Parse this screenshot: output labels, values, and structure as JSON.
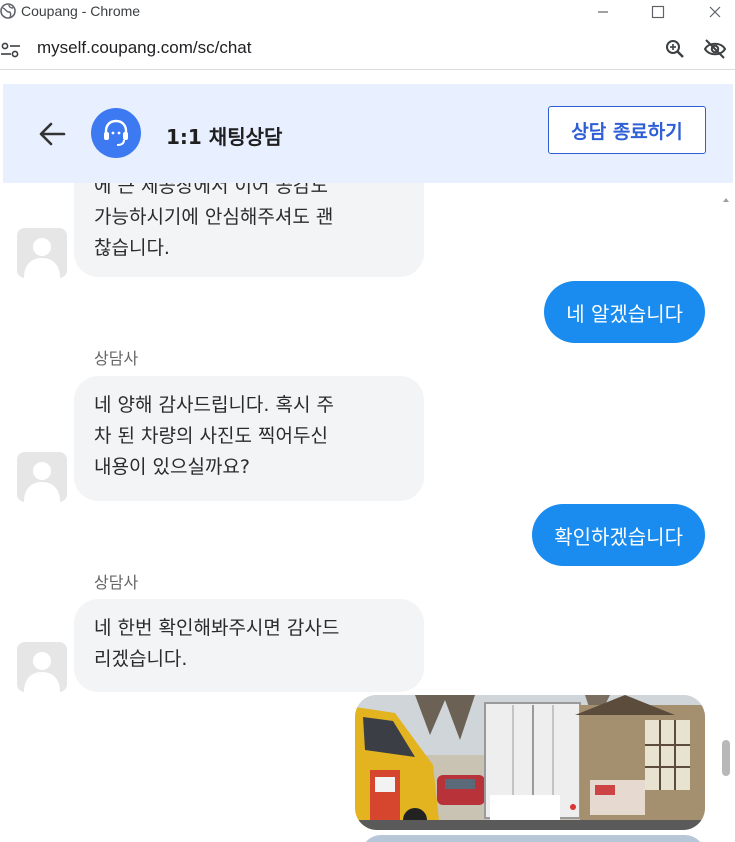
{
  "window": {
    "title": "Coupang - Chrome",
    "minimize_icon": "minimize-icon",
    "maximize_icon": "maximize-icon",
    "close_icon": "close-icon"
  },
  "address_bar": {
    "url": "myself.coupang.com/sc/chat",
    "icons": [
      "site-info-icon",
      "zoom-icon",
      "eye-off-icon"
    ]
  },
  "header": {
    "title": "1:1 채팅상담",
    "end_button": "상담 종료하기",
    "accent_color": "#2f5fd6",
    "background_color": "#e8efff"
  },
  "messages": [
    {
      "from": "agent",
      "lines": [
        "에 큰 제공장에서 이어 공감도",
        "가능하시기에 안심해주셔도 괜",
        "찮습니다."
      ]
    },
    {
      "from": "user",
      "text": "네 알겠습니다"
    },
    {
      "from": "agent",
      "sender": "상담사",
      "lines": [
        "네 양해 감사드립니다. 혹시 주",
        "차 된 차량의 사진도 찍어두신",
        "내용이 있으실까요?"
      ]
    },
    {
      "from": "user",
      "text": "확인하겠습니다"
    },
    {
      "from": "agent",
      "sender": "상담사",
      "lines": [
        "네 한번 확인해봐주시면 감사드",
        "리겠습니다."
      ]
    },
    {
      "from": "user",
      "type": "image"
    }
  ],
  "colors": {
    "user_bubble": "#1a8cf0",
    "agent_bubble": "#f3f4f6"
  }
}
